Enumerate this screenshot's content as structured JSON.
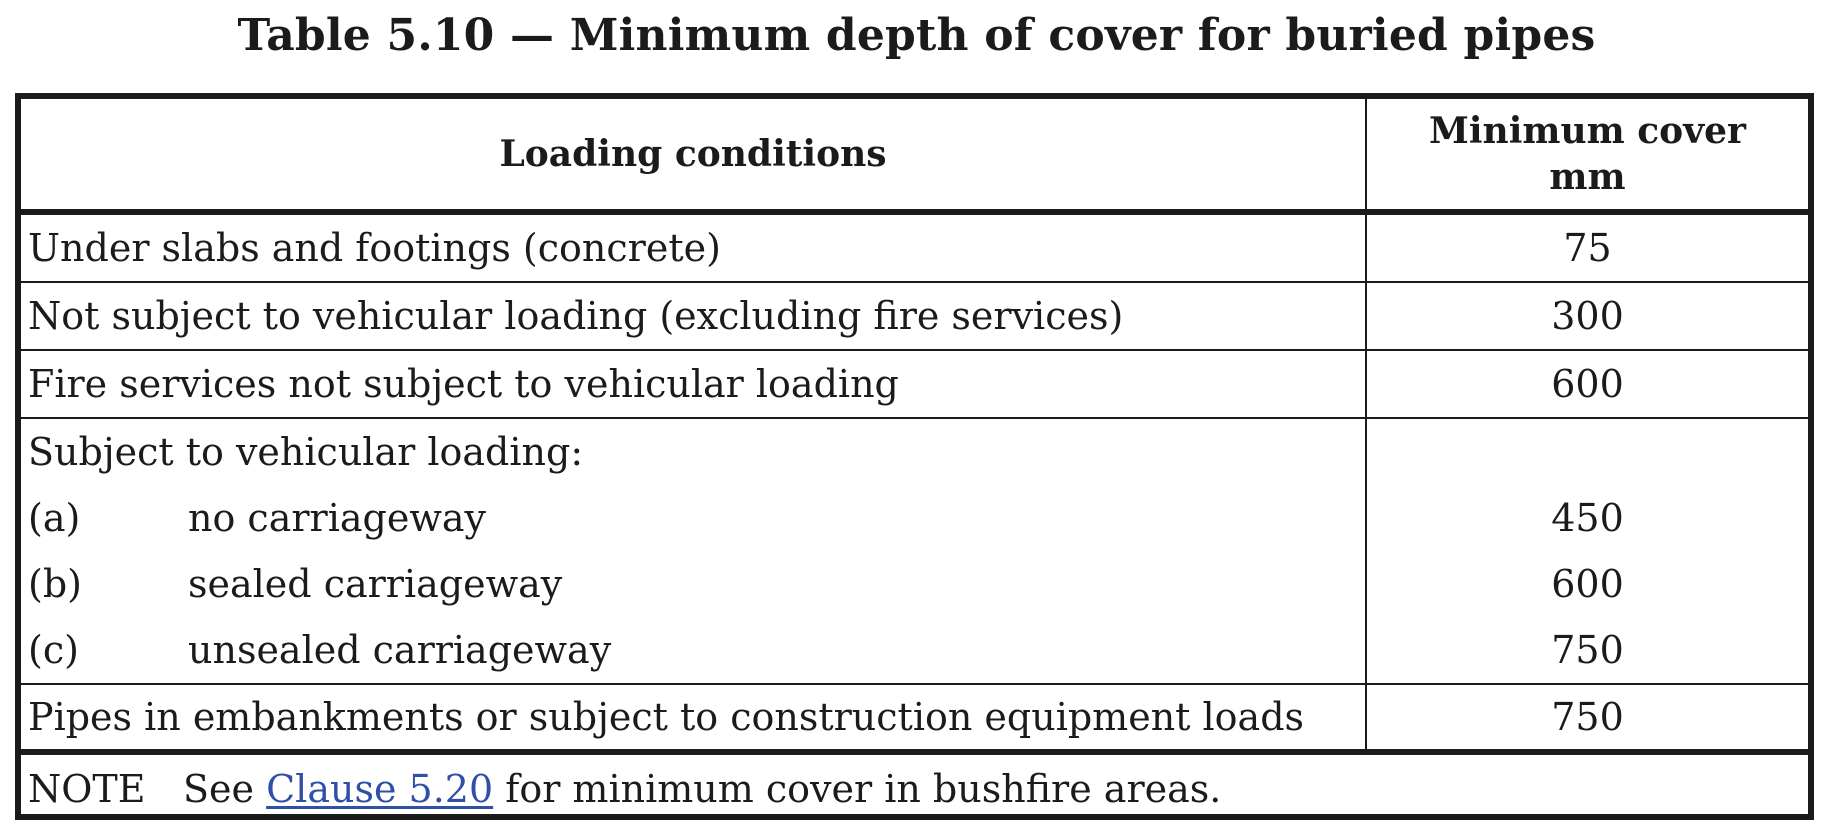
{
  "caption": "Table 5.10 — Minimum depth of cover for buried pipes",
  "table": {
    "headers": {
      "col1": "Loading conditions",
      "col2_line1": "Minimum cover",
      "col2_line2": "mm"
    },
    "rows": [
      {
        "condition": "Under slabs and footings (concrete)",
        "value": "75"
      },
      {
        "condition": "Not subject to vehicular loading (excluding fire services)",
        "value": "300"
      },
      {
        "condition": "Fire services not subject to vehicular loading",
        "value": "600"
      }
    ],
    "group": {
      "heading": "Subject to vehicular loading:",
      "items": [
        {
          "key": "(a)",
          "label": "no carriageway",
          "value": "450"
        },
        {
          "key": "(b)",
          "label": "sealed carriageway",
          "value": "600"
        },
        {
          "key": "(c)",
          "label": "unsealed carriageway",
          "value": "750"
        }
      ]
    },
    "last_row": {
      "condition": "Pipes in embankments or subject to construction equipment loads",
      "value": "750"
    }
  },
  "note": {
    "label": "NOTE",
    "prefix": "See",
    "link": "Clause 5.20",
    "suffix": "for minimum cover in bushfire areas."
  }
}
